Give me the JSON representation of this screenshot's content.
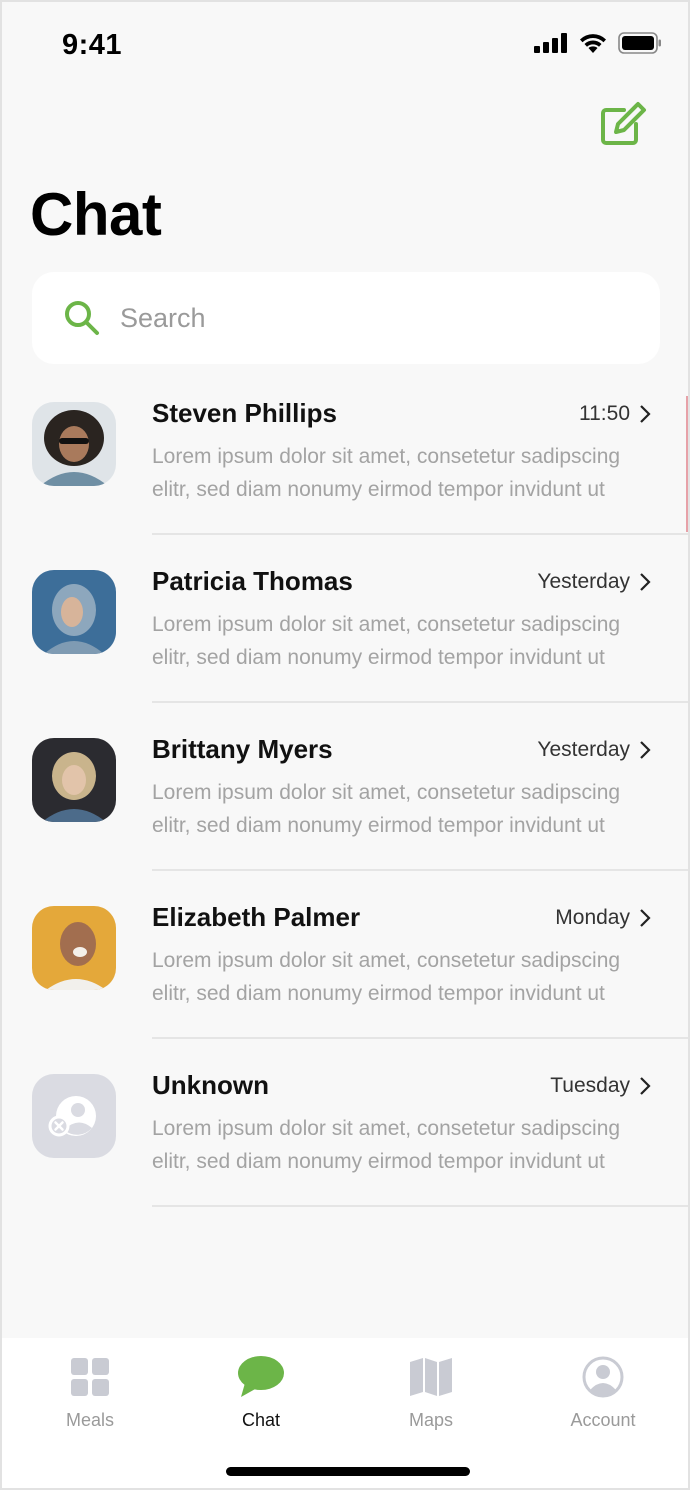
{
  "status_bar": {
    "time": "9:41"
  },
  "header": {
    "title": "Chat"
  },
  "search": {
    "placeholder": "Search"
  },
  "chats": [
    {
      "name": "Steven Phillips",
      "time": "11:50",
      "preview_line1": "Lorem ipsum dolor sit amet, consetetur sadipscing",
      "preview_line2": "elitr, sed diam nonumy eirmod tempor invidunt ut"
    },
    {
      "name": "Patricia Thomas",
      "time": "Yesterday",
      "preview_line1": "Lorem ipsum dolor sit amet, consetetur sadipscing",
      "preview_line2": "elitr, sed diam nonumy eirmod tempor invidunt ut"
    },
    {
      "name": "Brittany Myers",
      "time": "Yesterday",
      "preview_line1": "Lorem ipsum dolor sit amet, consetetur sadipscing",
      "preview_line2": "elitr, sed diam nonumy eirmod tempor invidunt ut"
    },
    {
      "name": "Elizabeth Palmer",
      "time": "Monday",
      "preview_line1": "Lorem ipsum dolor sit amet, consetetur sadipscing",
      "preview_line2": "elitr, sed diam nonumy eirmod tempor invidunt ut"
    },
    {
      "name": "Unknown",
      "time": "Tuesday",
      "preview_line1": "Lorem ipsum dolor sit amet, consetetur sadipscing",
      "preview_line2": "elitr, sed diam nonumy eirmod tempor invidunt ut"
    }
  ],
  "tabs": [
    {
      "label": "Meals",
      "icon": "grid-icon"
    },
    {
      "label": "Chat",
      "icon": "chat-bubble-icon"
    },
    {
      "label": "Maps",
      "icon": "map-icon"
    },
    {
      "label": "Account",
      "icon": "account-icon"
    }
  ],
  "colors": {
    "accent": "#6cb548",
    "inactive": "#c9cbd3",
    "background": "#f8f8f8"
  }
}
